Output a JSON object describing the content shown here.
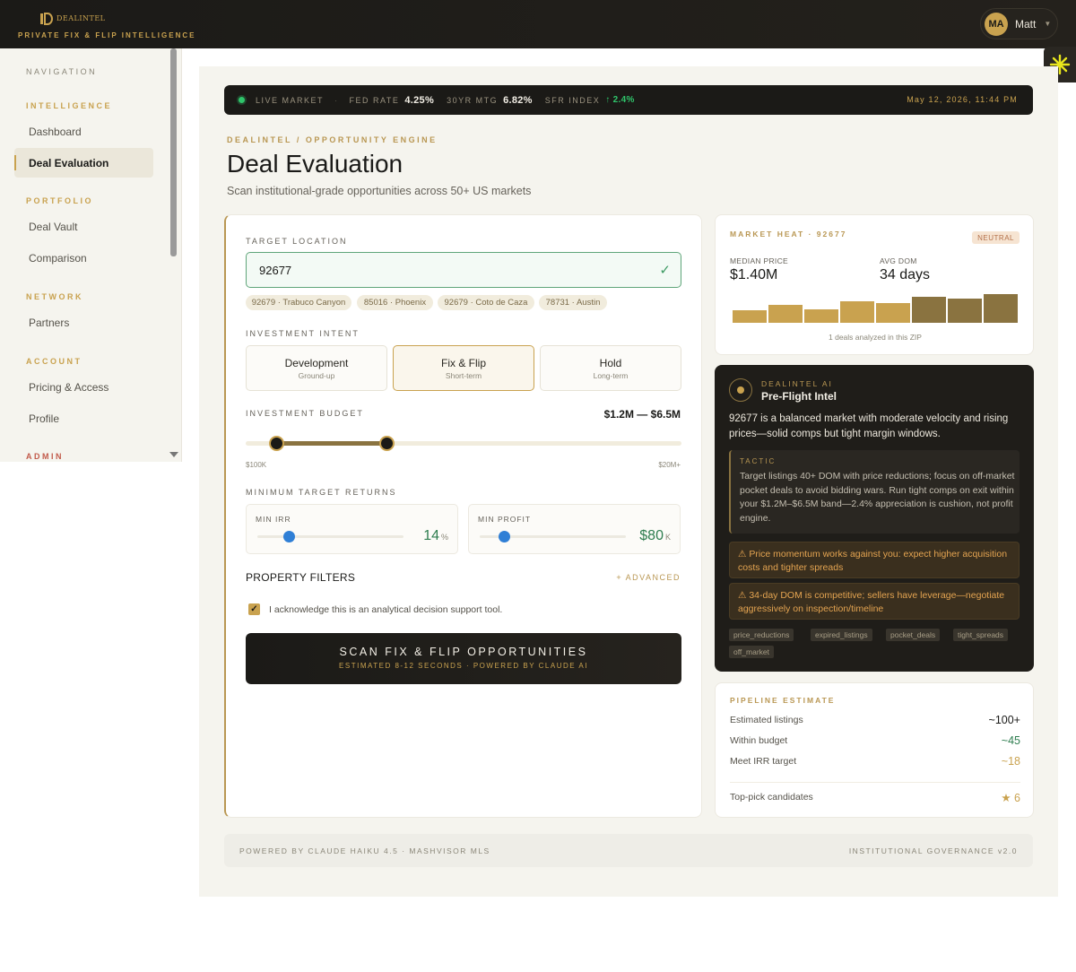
{
  "brand": {
    "name": "DEALINTEL",
    "tagline": "PRIVATE FIX & FLIP INTELLIGENCE",
    "accent": "#c9a24f"
  },
  "user": {
    "initials": "MA",
    "name": "Matt"
  },
  "sidebar": {
    "nav_heading": "NAVIGATION",
    "sections": [
      {
        "heading": "INTELLIGENCE",
        "items": [
          "Dashboard",
          "Deal Evaluation"
        ]
      },
      {
        "heading": "PORTFOLIO",
        "items": [
          "Deal Vault",
          "Comparison"
        ]
      },
      {
        "heading": "NETWORK",
        "items": [
          "Partners"
        ]
      },
      {
        "heading": "ACCOUNT",
        "items": [
          "Pricing & Access",
          "Profile"
        ]
      },
      {
        "heading": "ADMIN",
        "items": []
      }
    ],
    "active_item": "Deal Evaluation"
  },
  "ticker": {
    "live": "LIVE MARKET",
    "fed_label": "FED RATE",
    "fed_value": "4.25%",
    "mtg_label": "30YR MTG",
    "mtg_value": "6.82%",
    "sfr_label": "SFR INDEX",
    "sfr_value": "↑ 2.4%",
    "datetime": "May 12, 2026, 11:44 PM"
  },
  "page": {
    "breadcrumb": "DEALINTEL / OPPORTUNITY ENGINE",
    "title": "Deal Evaluation",
    "subtitle": "Scan institutional-grade opportunities across 50+ US markets"
  },
  "form": {
    "location_label": "TARGET LOCATION",
    "location_value": "92677",
    "location_check": "✓",
    "recent_chips": [
      "92679 · Trabuco Canyon",
      "85016 · Phoenix",
      "92679 · Coto de Caza",
      "78731 · Austin"
    ],
    "intent_label": "INVESTMENT INTENT",
    "intents": [
      {
        "title": "Development",
        "sub": "Ground-up"
      },
      {
        "title": "Fix & Flip",
        "sub": "Short-term"
      },
      {
        "title": "Hold",
        "sub": "Long-term"
      }
    ],
    "intent_selected": "Fix & Flip",
    "budget_label": "INVESTMENT BUDGET",
    "budget_display": "$1.2M — $6.5M",
    "budget_min_label": "$100K",
    "budget_max_label": "$20M+",
    "budget_low_fraction": 0.07,
    "budget_high_fraction": 0.325,
    "returns_label": "MINIMUM TARGET RETURNS",
    "min_irr_label": "MIN IRR",
    "min_irr_value": "14",
    "min_irr_unit": "%",
    "min_irr_fraction": 0.22,
    "min_profit_label": "MIN PROFIT",
    "min_profit_value": "$80",
    "min_profit_unit": "K",
    "min_profit_fraction": 0.17,
    "filters_title": "PROPERTY FILTERS",
    "advanced_link": "+ ADVANCED",
    "ack_checked": true,
    "ack_text": "I acknowledge this is an analytical decision support tool.",
    "scan_title": "SCAN FIX & FLIP OPPORTUNITIES",
    "scan_sub": "ESTIMATED 8-12 SECONDS · POWERED BY CLAUDE AI"
  },
  "market_heat": {
    "label": "MARKET HEAT · 92677",
    "badge": "NEUTRAL",
    "median_label": "MEDIAN PRICE",
    "median_value": "$1.40M",
    "dom_label": "AVG DOM",
    "dom_value": "34 days",
    "bar_levels": [
      0.4,
      0.58,
      0.45,
      0.72,
      0.66,
      0.85,
      0.78,
      0.94
    ],
    "bar_colors": [
      "#c9a24f",
      "#c9a24f",
      "#c9a24f",
      "#c9a24f",
      "#c9a24f",
      "#8a7340",
      "#8a7340",
      "#8a7340"
    ],
    "footnote": "1 deals analyzed in this ZIP"
  },
  "ai": {
    "label": "DEALINTEL AI",
    "title": "Pre-Flight Intel",
    "summary": "92677 is a balanced market with moderate velocity and rising prices—solid comps but tight margin windows.",
    "tactic_label": "TACTIC",
    "tactic_text": "Target listings 40+ DOM with price reductions; focus on off-market pocket deals to avoid bidding wars. Run tight comps on exit within your $1.2M–$6.5M band—2.4% appreciation is cushion, not profit engine.",
    "warnings": [
      "⚠ Price momentum works against you: expect higher acquisition costs and tighter spreads",
      "⚠ 34-day DOM is competitive; sellers have leverage—negotiate aggressively on inspection/timeline"
    ],
    "tags": [
      "price_reductions",
      "expired_listings",
      "pocket_deals",
      "tight_spreads",
      "off_market"
    ]
  },
  "pipeline": {
    "label": "PIPELINE ESTIMATE",
    "rows": [
      {
        "label": "Estimated listings",
        "value": "~100+",
        "color": "#1a1a18"
      },
      {
        "label": "Within budget",
        "value": "~45",
        "color": "#2e7d4f"
      },
      {
        "label": "Meet IRR target",
        "value": "~18",
        "color": "#c9a24f"
      }
    ],
    "top_label": "Top-pick candidates",
    "top_value": "★ 6"
  },
  "footer": {
    "left": "POWERED BY CLAUDE HAIKU 4.5 · MASHVISOR MLS",
    "right": "INSTITUTIONAL GOVERNANCE v2.0"
  }
}
